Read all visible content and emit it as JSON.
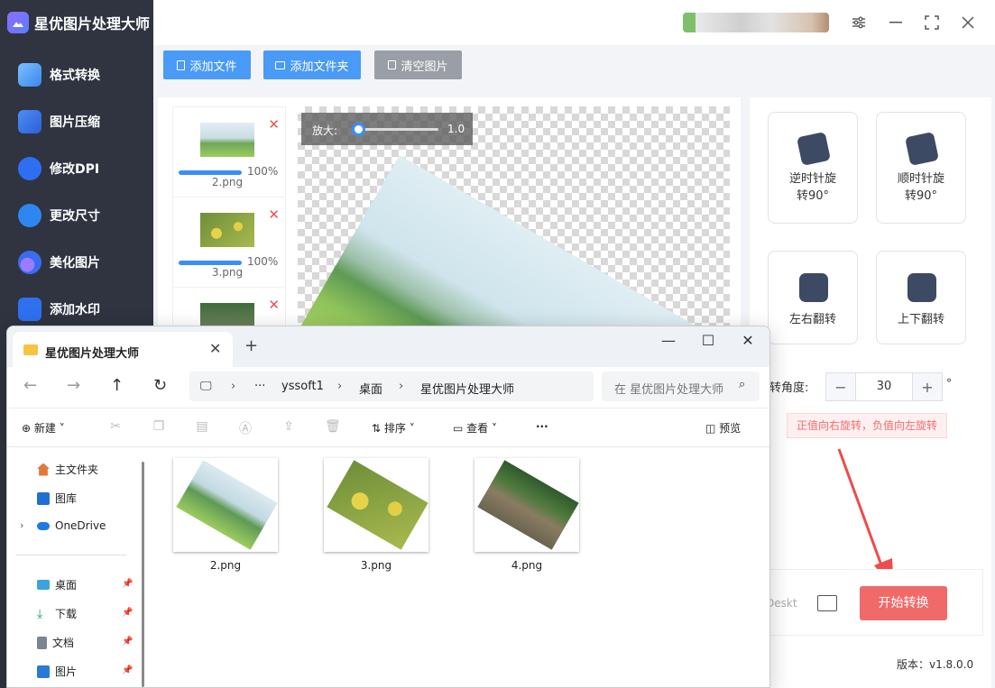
{
  "app": {
    "title": "星优图片处理大师",
    "nav": [
      {
        "label": "格式转换",
        "color": "#5aa7ff"
      },
      {
        "label": "图片压缩",
        "color": "#3a7bef"
      },
      {
        "label": "修改DPI",
        "color": "#2e6ff2"
      },
      {
        "label": "更改尺寸",
        "color": "#2f86f0"
      },
      {
        "label": "美化图片",
        "color": "#3b6cf0"
      },
      {
        "label": "添加水印",
        "color": "#2f70ef"
      }
    ],
    "toolbar": {
      "add_file": "添加文件",
      "add_folder": "添加文件夹",
      "clear": "清空图片"
    },
    "files": [
      {
        "name": "2.png",
        "progress": "100%"
      },
      {
        "name": "3.png",
        "progress": "100%"
      },
      {
        "name": "",
        "progress": ""
      }
    ],
    "zoom": {
      "label": "放大:",
      "value": "1.0"
    },
    "rotate_ccw": {
      "line1": "逆时针旋",
      "line2": "转90°"
    },
    "rotate_cw": {
      "line1": "顺时针旋",
      "line2": "转90°"
    },
    "flip_h": {
      "label": "左右翻转"
    },
    "flip_v": {
      "label": "上下翻转"
    },
    "angle": {
      "label": "转角度:",
      "value": "30",
      "unit": "°"
    },
    "hint": "正值向右旋转，负值向左旋转",
    "output_path": "Deskt",
    "start": "开始转换",
    "version": "版本：v1.8.0.0",
    "accent": "#3a8ff7",
    "danger": "#f06a6a"
  },
  "explorer": {
    "tab_title": "星优图片处理大师",
    "address": [
      "yssoft1",
      "桌面",
      "星优图片处理大师"
    ],
    "search_placeholder": "在 星优图片处理大师",
    "commands": {
      "new": "新建",
      "sort": "排序",
      "view": "查看",
      "more": "···",
      "preview": "预览"
    },
    "nav": [
      {
        "label": "主文件夹",
        "icon": "home-icon",
        "pinned": false
      },
      {
        "label": "图库",
        "icon": "gallery-icon",
        "pinned": false
      },
      {
        "label": "OneDrive",
        "icon": "cloud-icon",
        "pinned": false
      },
      {
        "label": "桌面",
        "icon": "desktop-icon",
        "pinned": true
      },
      {
        "label": "下载",
        "icon": "download-icon",
        "pinned": true
      },
      {
        "label": "文档",
        "icon": "document-icon",
        "pinned": true
      },
      {
        "label": "图片",
        "icon": "pictures-icon",
        "pinned": true
      }
    ],
    "files": [
      "2.png",
      "3.png",
      "4.png"
    ]
  }
}
